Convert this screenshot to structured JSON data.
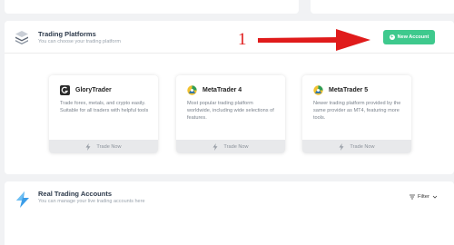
{
  "platforms_panel": {
    "title": "Trading Platforms",
    "subtitle": "You can choose your trading platform",
    "new_account_label": "New Account",
    "icon": "stacked-layers-icon"
  },
  "annotation": {
    "number": "1",
    "color": "#e01b1b"
  },
  "platforms": [
    {
      "name": "GloryTrader",
      "description": "Trade forex, metals, and crypto easily. Suitable for all traders with helpful tools",
      "action_label": "Trade Now",
      "logo": "glorytrader-logo-icon"
    },
    {
      "name": "MetaTrader 4",
      "description": "Most popular trading platform worldwide, including wide selections of features.",
      "action_label": "Trade Now",
      "logo": "metatrader-logo-icon"
    },
    {
      "name": "MetaTrader 5",
      "description": "Newer trading platform provided by the same provider as MT4, featuring more tools.",
      "action_label": "Trade Now",
      "logo": "metatrader-logo-icon"
    }
  ],
  "real_accounts_panel": {
    "title": "Real Trading Accounts",
    "subtitle": "You can manage your live trading accounts here",
    "filter_label": "Filter",
    "icon": "lightning-bolt-icon"
  },
  "colors": {
    "accent_green": "#3ec98d",
    "top_button_blue": "#2b8fe6",
    "background": "#f1f2f4"
  }
}
